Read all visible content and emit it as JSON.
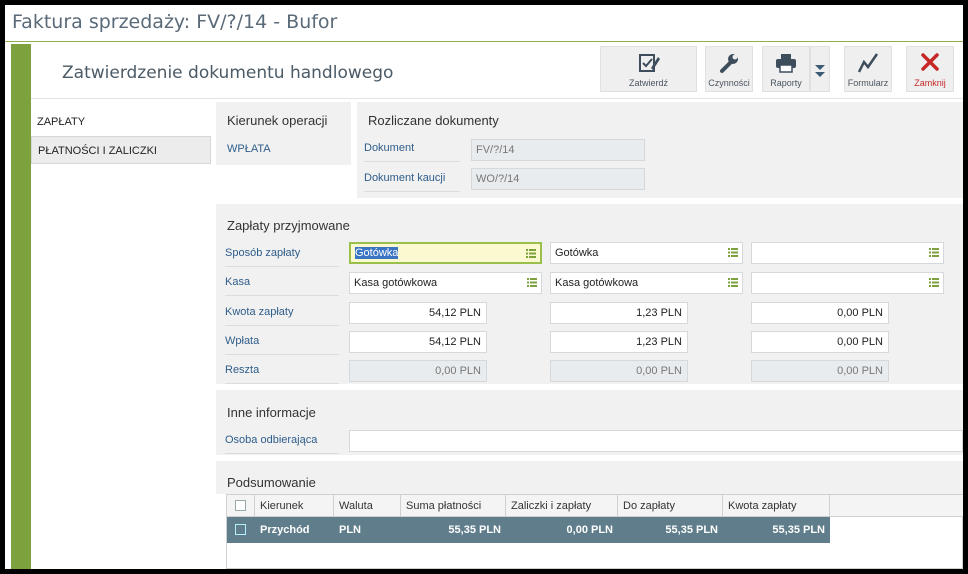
{
  "window": {
    "title": "Faktura sprzedaży: FV/?/14 - Bufor"
  },
  "header": {
    "doc_title": "Zatwierdzenie dokumentu handlowego"
  },
  "toolbar": {
    "approve": "Zatwierdź",
    "actions": "Czynności",
    "reports": "Raporty",
    "form": "Formularz",
    "close": "Zamknij"
  },
  "nav": {
    "items": [
      "ZAPŁATY",
      "PŁATNOŚCI I ZALICZKI"
    ]
  },
  "direction": {
    "title": "Kierunek operacji",
    "value": "WPŁATA"
  },
  "settled": {
    "title": "Rozliczane dokumenty",
    "document_label": "Dokument",
    "document_value": "FV/?/14",
    "deposit_label": "Dokument kaucji",
    "deposit_value": "WO/?/14"
  },
  "payments": {
    "title": "Zapłaty przyjmowane",
    "labels": {
      "method": "Sposób zapłaty",
      "cashbox": "Kasa",
      "amount": "Kwota zapłaty",
      "paid": "Wpłata",
      "change": "Reszta"
    },
    "columns": [
      {
        "method": "Gotówka",
        "cashbox": "Kasa gotówkowa",
        "amount": "54,12 PLN",
        "paid": "54,12 PLN",
        "change": "0,00 PLN"
      },
      {
        "method": "Gotówka",
        "cashbox": "Kasa gotówkowa",
        "amount": "1,23 PLN",
        "paid": "1,23 PLN",
        "change": "0,00 PLN"
      },
      {
        "method": "",
        "cashbox": "",
        "amount": "0,00 PLN",
        "paid": "0,00 PLN",
        "change": "0,00 PLN"
      }
    ]
  },
  "other": {
    "title": "Inne informacje",
    "recipient_label": "Osoba odbierająca",
    "recipient_value": ""
  },
  "summary": {
    "title": "Podsumowanie",
    "headers": [
      "Kierunek",
      "Waluta",
      "Suma płatności",
      "Zaliczki i zapłaty",
      "Do zapłaty",
      "Kwota zapłaty"
    ],
    "rows": [
      {
        "direction": "Przychód",
        "currency": "PLN",
        "total": "55,35 PLN",
        "advances": "0,00 PLN",
        "due": "55,35 PLN",
        "amount": "55,35 PLN"
      }
    ]
  },
  "colors": {
    "accent_green": "#7da13d",
    "close_red": "#c62828",
    "selected_row": "#607d8b",
    "label_blue": "#2e5d8a"
  },
  "icons": {
    "approve": "approve-icon",
    "actions": "wrench-icon",
    "reports": "printer-icon",
    "more": "chevron-double-down-icon",
    "form": "form-icon",
    "close": "close-icon",
    "list": "list-icon"
  }
}
